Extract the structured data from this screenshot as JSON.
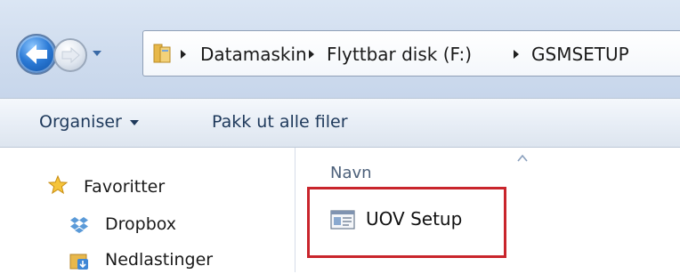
{
  "address_bar": {
    "breadcrumbs": [
      "Datamaskin",
      "Flyttbar disk (F:)",
      "GSMSETUP"
    ],
    "folder_icon": "folder-icon"
  },
  "navigation": {
    "back_icon": "back-arrow-icon",
    "forward_icon": "forward-arrow-icon",
    "recent_icon": "chevron-down-icon"
  },
  "toolbar": {
    "organize_label": "Organiser",
    "extract_label": "Pakk ut alle filer"
  },
  "nav_pane": {
    "items": [
      {
        "label": "Favoritter",
        "icon": "star-icon"
      },
      {
        "label": "Dropbox",
        "icon": "dropbox-icon"
      },
      {
        "label": "Nedlastinger",
        "icon": "downloads-folder-icon"
      }
    ]
  },
  "file_list": {
    "column_name": "Navn",
    "files": [
      {
        "name": "UOV Setup",
        "icon": "setup-file-icon"
      }
    ],
    "highlight_color": "#c9252c"
  }
}
